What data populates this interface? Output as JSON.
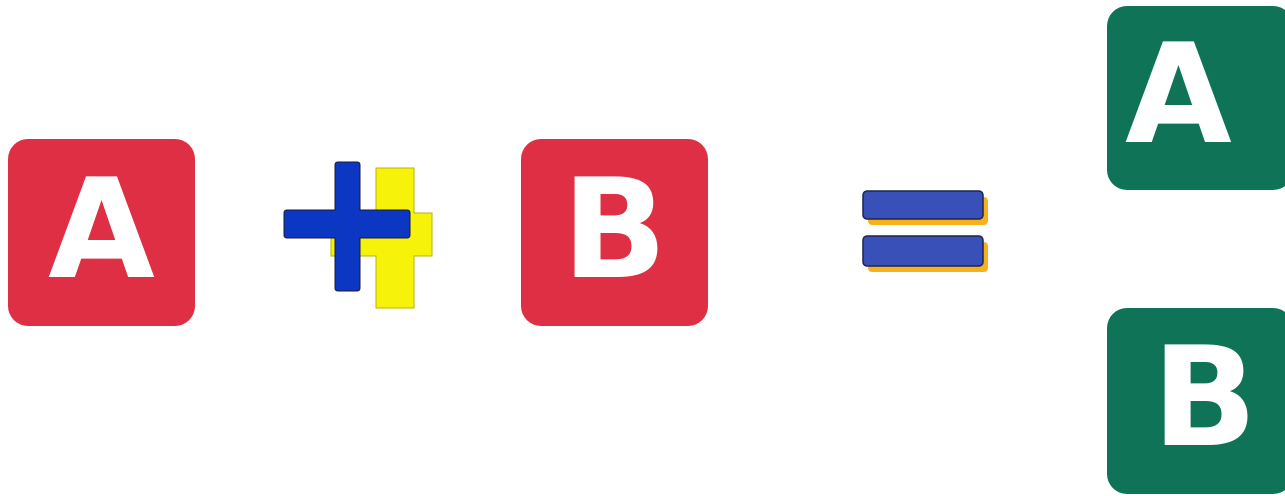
{
  "colors": {
    "left_tile": "#df2f45",
    "right_tile": "#0f7457",
    "tile_text": "#ffffff",
    "plus_fill": "#0b37c3",
    "plus_shadow": "#f6f20a",
    "equals_fill": "#3950b9",
    "equals_shadow": "#f5b21c"
  },
  "equation": {
    "left_operand_a": "A",
    "operator_plus_icon": "plus-icon",
    "left_operand_b": "B",
    "operator_equals_icon": "equals-icon",
    "result_a": "A",
    "result_b": "B"
  }
}
